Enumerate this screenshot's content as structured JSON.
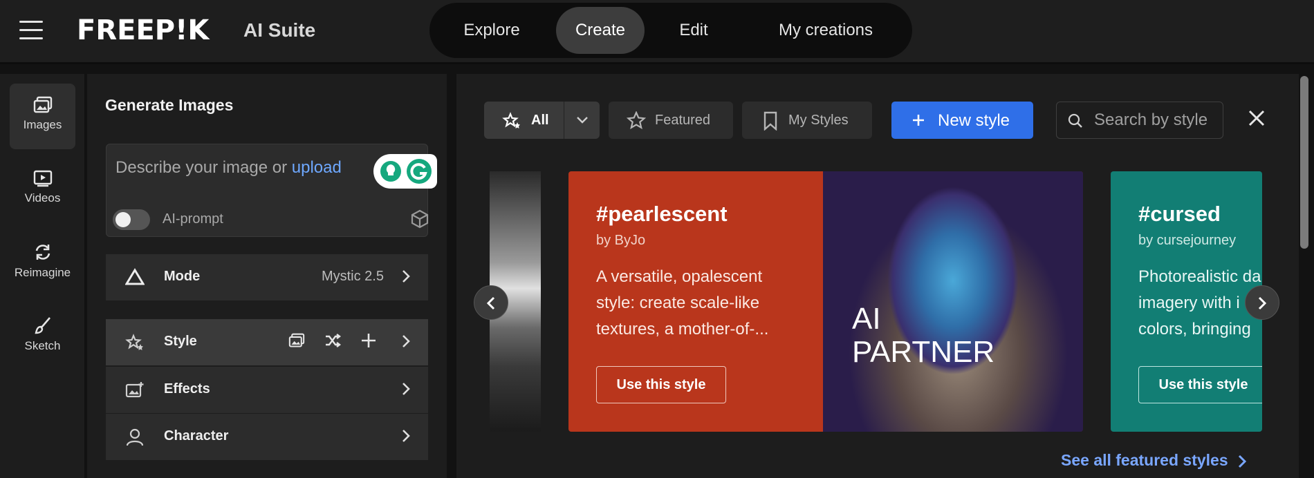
{
  "header": {
    "logo": "FREEP!K",
    "suite": "AI Suite",
    "nav": [
      "Explore",
      "Create",
      "Edit",
      "My creations"
    ],
    "active_nav": "Create"
  },
  "rail": {
    "items": [
      {
        "label": "Images",
        "icon": "images-icon"
      },
      {
        "label": "Videos",
        "icon": "video-icon"
      },
      {
        "label": "Reimagine",
        "icon": "refresh-icon"
      },
      {
        "label": "Sketch",
        "icon": "brush-icon"
      }
    ],
    "active": "Images"
  },
  "panel": {
    "title": "Generate Images",
    "prompt_placeholder": "Describe your image or",
    "prompt_link": "upload",
    "ai_prompt_label": "AI-prompt",
    "mode_label": "Mode",
    "mode_value": "Mystic 2.5",
    "style_label": "Style",
    "effects_label": "Effects",
    "character_label": "Character"
  },
  "toolbar": {
    "all_label": "All",
    "featured_label": "Featured",
    "my_styles_label": "My Styles",
    "new_style_label": "New style",
    "search_placeholder": "Search by style"
  },
  "cards": [
    {
      "title": "#pearlescent",
      "author": "by ByJo",
      "description": "A versatile, opalescent style: create scale-like textures, a mother-of-...",
      "button": "Use this style",
      "overlay_text": [
        "AI",
        "PARTNER"
      ]
    },
    {
      "title": "#cursed",
      "author": "by cursejourney",
      "description_lines": [
        "Photorealistic da",
        "imagery with i",
        "colors, bringing"
      ],
      "button": "Use this style"
    }
  ],
  "see_all": "See all featured styles",
  "colors": {
    "accent": "#2f6fe8",
    "link": "#7aa7ff",
    "card1_bg": "#b9361c",
    "card2_bg": "#127e74"
  }
}
